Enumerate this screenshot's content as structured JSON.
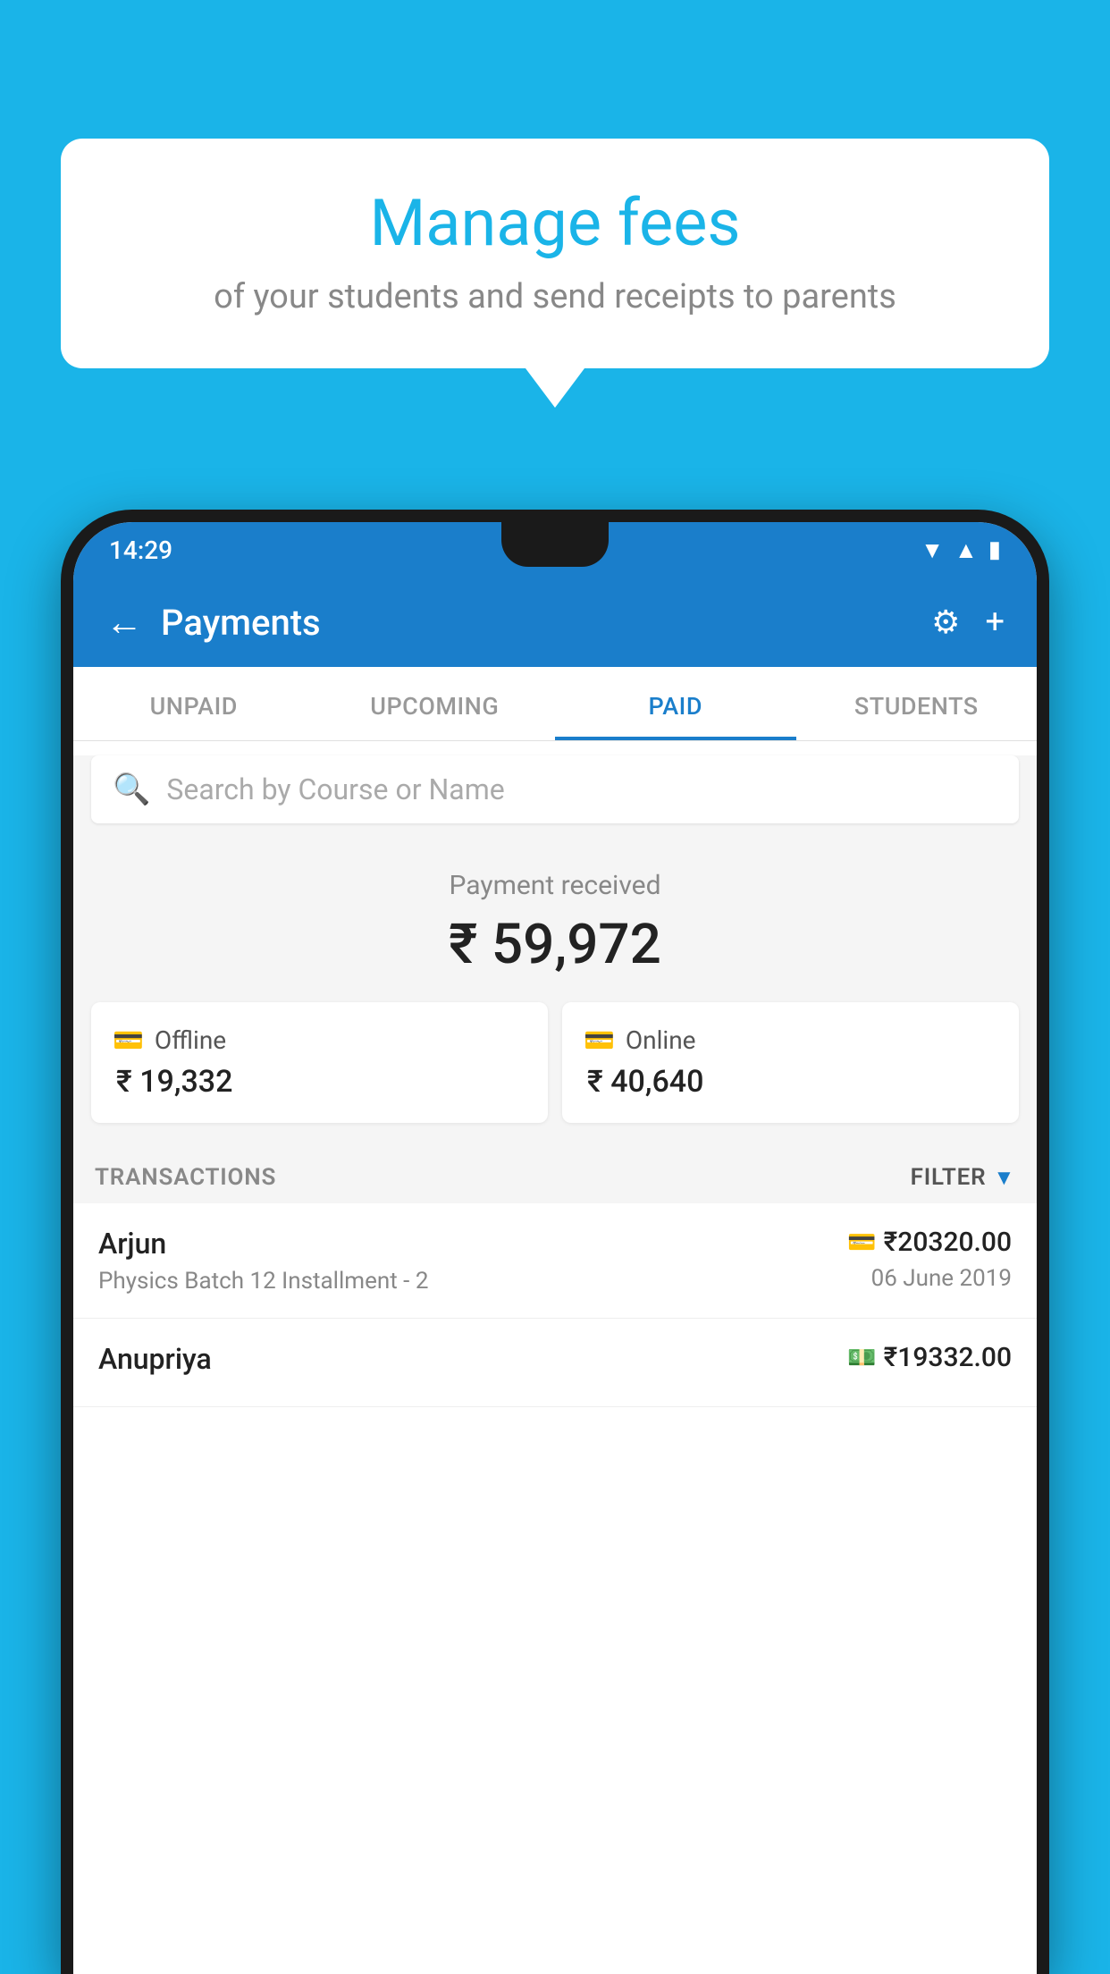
{
  "background_color": "#1ab4e8",
  "bubble": {
    "title": "Manage fees",
    "subtitle": "of your students and send receipts to parents"
  },
  "status_bar": {
    "time": "14:29"
  },
  "app_bar": {
    "title": "Payments",
    "back_label": "←",
    "settings_label": "⚙",
    "add_label": "+"
  },
  "tabs": [
    {
      "label": "UNPAID",
      "active": false
    },
    {
      "label": "UPCOMING",
      "active": false
    },
    {
      "label": "PAID",
      "active": true
    },
    {
      "label": "STUDENTS",
      "active": false
    }
  ],
  "search": {
    "placeholder": "Search by Course or Name"
  },
  "payment_summary": {
    "label": "Payment received",
    "amount": "₹ 59,972",
    "offline": {
      "label": "Offline",
      "amount": "₹ 19,332"
    },
    "online": {
      "label": "Online",
      "amount": "₹ 40,640"
    }
  },
  "transactions": {
    "header_label": "TRANSACTIONS",
    "filter_label": "FILTER",
    "items": [
      {
        "name": "Arjun",
        "detail": "Physics Batch 12 Installment - 2",
        "amount": "₹20320.00",
        "date": "06 June 2019",
        "icon_type": "card"
      },
      {
        "name": "Anupriya",
        "detail": "",
        "amount": "₹19332.00",
        "date": "",
        "icon_type": "cash"
      }
    ]
  }
}
